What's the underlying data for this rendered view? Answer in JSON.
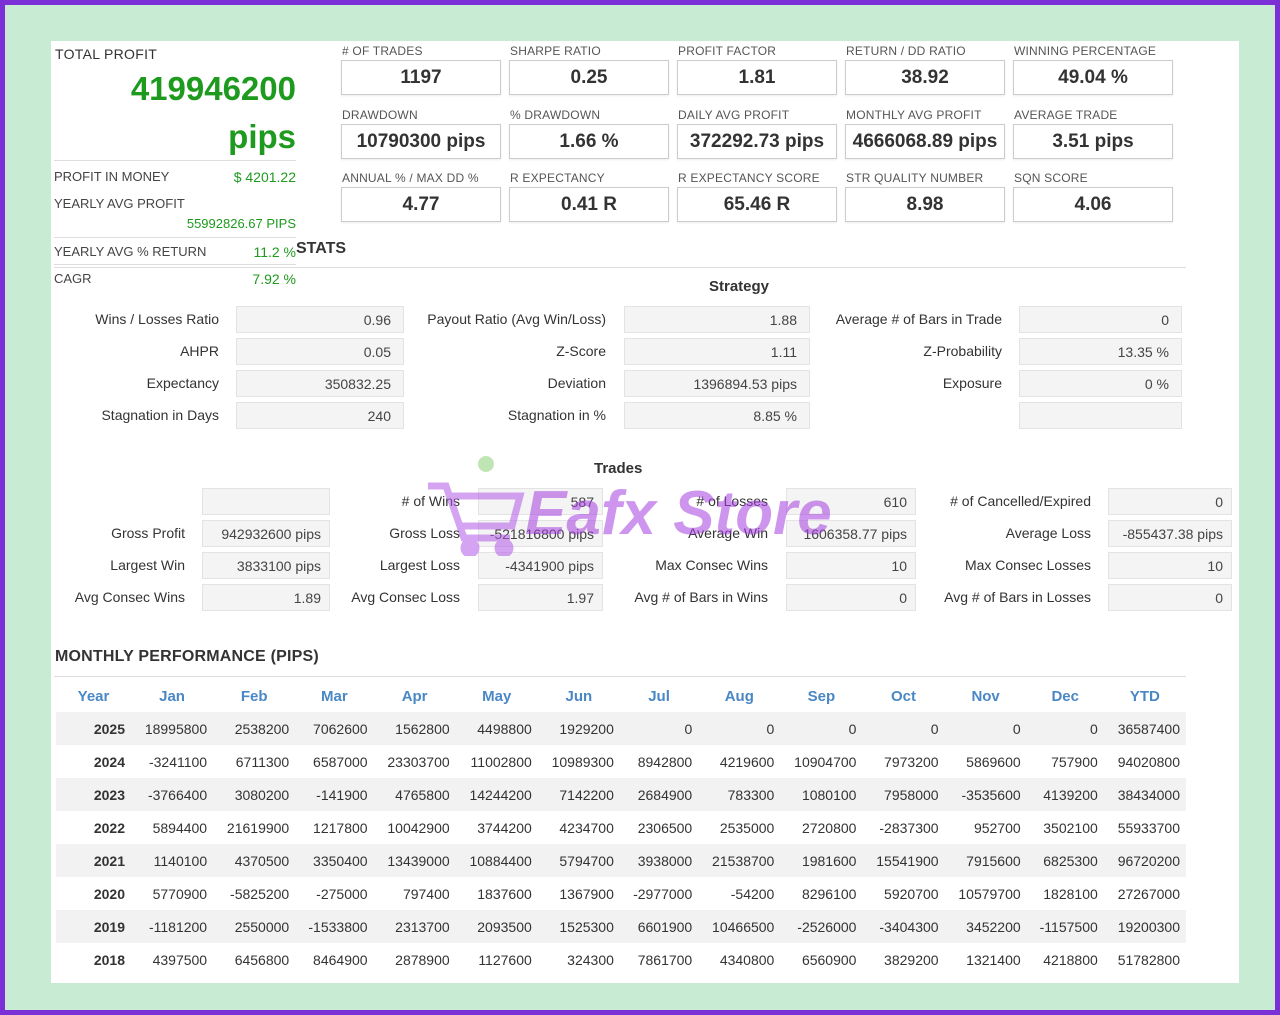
{
  "summary": {
    "total_profit_label": "TOTAL PROFIT",
    "total_profit_value": "419946200",
    "total_profit_unit": "pips",
    "profit_in_money_label": "PROFIT IN MONEY",
    "profit_in_money_value": "$ 4201.22",
    "yearly_avg_profit_label": "YEARLY AVG PROFIT",
    "yearly_avg_profit_value": "55992826.67 PIPS",
    "yearly_avg_return_label": "YEARLY AVG % RETURN",
    "yearly_avg_return_value": "11.2 %",
    "cagr_label": "CAGR",
    "cagr_value": "7.92 %"
  },
  "metrics": [
    {
      "label": "# OF TRADES",
      "value": "1197"
    },
    {
      "label": "SHARPE RATIO",
      "value": "0.25"
    },
    {
      "label": "PROFIT FACTOR",
      "value": "1.81"
    },
    {
      "label": "RETURN / DD RATIO",
      "value": "38.92"
    },
    {
      "label": "WINNING PERCENTAGE",
      "value": "49.04 %"
    },
    {
      "label": "DRAWDOWN",
      "value": "10790300 pips"
    },
    {
      "label": "% DRAWDOWN",
      "value": "1.66 %"
    },
    {
      "label": "DAILY AVG PROFIT",
      "value": "372292.73 pips"
    },
    {
      "label": "MONTHLY AVG PROFIT",
      "value": "4666068.89 pips"
    },
    {
      "label": "AVERAGE TRADE",
      "value": "3.51 pips"
    },
    {
      "label": "ANNUAL % / MAX DD %",
      "value": "4.77"
    },
    {
      "label": "R EXPECTANCY",
      "value": "0.41 R"
    },
    {
      "label": "R EXPECTANCY SCORE",
      "value": "65.46 R"
    },
    {
      "label": "STR QUALITY NUMBER",
      "value": "8.98"
    },
    {
      "label": "SQN SCORE",
      "value": "4.06"
    }
  ],
  "stats_title": "STATS",
  "strategy": {
    "title": "Strategy",
    "rows": [
      [
        {
          "label": "Wins / Losses Ratio",
          "value": "0.96"
        },
        {
          "label": "Payout Ratio (Avg Win/Loss)",
          "value": "1.88"
        },
        {
          "label": "Average # of Bars in Trade",
          "value": "0"
        }
      ],
      [
        {
          "label": "AHPR",
          "value": "0.05"
        },
        {
          "label": "Z-Score",
          "value": "1.11"
        },
        {
          "label": "Z-Probability",
          "value": "13.35 %"
        }
      ],
      [
        {
          "label": "Expectancy",
          "value": "350832.25"
        },
        {
          "label": "Deviation",
          "value": "1396894.53 pips"
        },
        {
          "label": "Exposure",
          "value": "0 %"
        }
      ],
      [
        {
          "label": "Stagnation in Days",
          "value": "240"
        },
        {
          "label": "Stagnation in %",
          "value": "8.85 %"
        },
        {
          "label": "",
          "value": ""
        }
      ]
    ]
  },
  "trades": {
    "title": "Trades",
    "rows": [
      [
        {
          "label": "",
          "value": ""
        },
        {
          "label": "# of Wins",
          "value": "587"
        },
        {
          "label": "# of Losses",
          "value": "610"
        },
        {
          "label": "# of Cancelled/Expired",
          "value": "0"
        }
      ],
      [
        {
          "label": "Gross Profit",
          "value": "942932600 pips"
        },
        {
          "label": "Gross Loss",
          "value": "-521816800 pips"
        },
        {
          "label": "Average Win",
          "value": "1606358.77 pips"
        },
        {
          "label": "Average Loss",
          "value": "-855437.38 pips"
        }
      ],
      [
        {
          "label": "Largest Win",
          "value": "3833100 pips"
        },
        {
          "label": "Largest Loss",
          "value": "-4341900 pips"
        },
        {
          "label": "Max Consec Wins",
          "value": "10"
        },
        {
          "label": "Max Consec Losses",
          "value": "10"
        }
      ],
      [
        {
          "label": "Avg Consec Wins",
          "value": "1.89"
        },
        {
          "label": "Avg Consec Loss",
          "value": "1.97"
        },
        {
          "label": "Avg # of Bars in Wins",
          "value": "0"
        },
        {
          "label": "Avg # of Bars in Losses",
          "value": "0"
        }
      ]
    ]
  },
  "monthly": {
    "title": "MONTHLY PERFORMANCE (PIPS)",
    "headers": [
      "Year",
      "Jan",
      "Feb",
      "Mar",
      "Apr",
      "May",
      "Jun",
      "Jul",
      "Aug",
      "Sep",
      "Oct",
      "Nov",
      "Dec",
      "YTD"
    ],
    "rows": [
      [
        "2025",
        "18995800",
        "2538200",
        "7062600",
        "1562800",
        "4498800",
        "1929200",
        "0",
        "0",
        "0",
        "0",
        "0",
        "0",
        "36587400"
      ],
      [
        "2024",
        "-3241100",
        "6711300",
        "6587000",
        "23303700",
        "11002800",
        "10989300",
        "8942800",
        "4219600",
        "10904700",
        "7973200",
        "5869600",
        "757900",
        "94020800"
      ],
      [
        "2023",
        "-3766400",
        "3080200",
        "-141900",
        "4765800",
        "14244200",
        "7142200",
        "2684900",
        "783300",
        "1080100",
        "7958000",
        "-3535600",
        "4139200",
        "38434000"
      ],
      [
        "2022",
        "5894400",
        "21619900",
        "1217800",
        "10042900",
        "3744200",
        "4234700",
        "2306500",
        "2535000",
        "2720800",
        "-2837300",
        "952700",
        "3502100",
        "55933700"
      ],
      [
        "2021",
        "1140100",
        "4370500",
        "3350400",
        "13439000",
        "10884400",
        "5794700",
        "3938000",
        "21538700",
        "1981600",
        "15541900",
        "7915600",
        "6825300",
        "96720200"
      ],
      [
        "2020",
        "5770900",
        "-5825200",
        "-275000",
        "797400",
        "1837600",
        "1367900",
        "-2977000",
        "-54200",
        "8296100",
        "5920700",
        "10579700",
        "1828100",
        "27267000"
      ],
      [
        "2019",
        "-1181200",
        "2550000",
        "-1533800",
        "2313700",
        "2093500",
        "1525300",
        "6601900",
        "10466500",
        "-2526000",
        "-3404300",
        "3452200",
        "-1157500",
        "19200300"
      ],
      [
        "2018",
        "4397500",
        "6456800",
        "8464900",
        "2878900",
        "1127600",
        "324300",
        "7861700",
        "4340800",
        "6560900",
        "3829200",
        "1321400",
        "4218800",
        "51782800"
      ]
    ]
  },
  "watermark": "Eafx Store",
  "colors": {
    "positive": "#1e9a1e",
    "negative": "#e03030",
    "header": "#4a87c5",
    "border": "#7b2fd6",
    "background": "#c7ecd3"
  }
}
